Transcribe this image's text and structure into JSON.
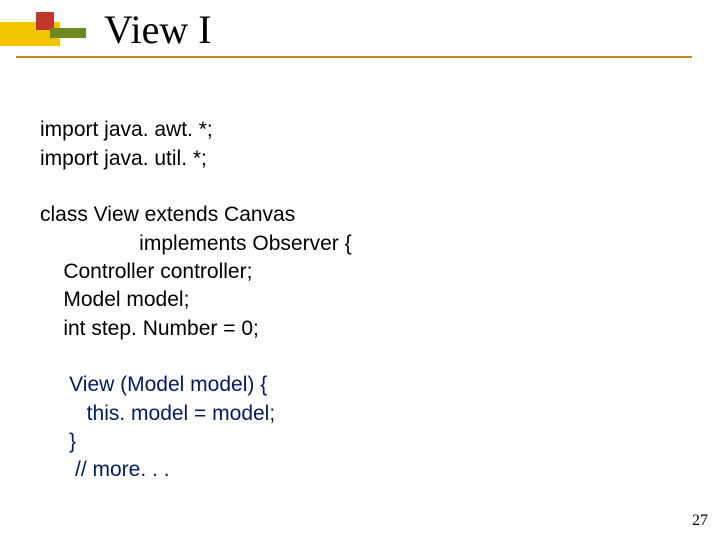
{
  "title": "View I",
  "code": {
    "l1": "import java. awt. *;",
    "l2": "import java. util. *;",
    "l3": "class View extends Canvas",
    "l4": "                 implements Observer {",
    "l5": "    Controller controller;",
    "l6": "    Model model;",
    "l7": "    int step. Number = 0;",
    "l8": "     View (Model model) {",
    "l9": "        this. model = model;",
    "l10": "     }",
    "l11": "      // more. . ."
  },
  "page_number": "27"
}
